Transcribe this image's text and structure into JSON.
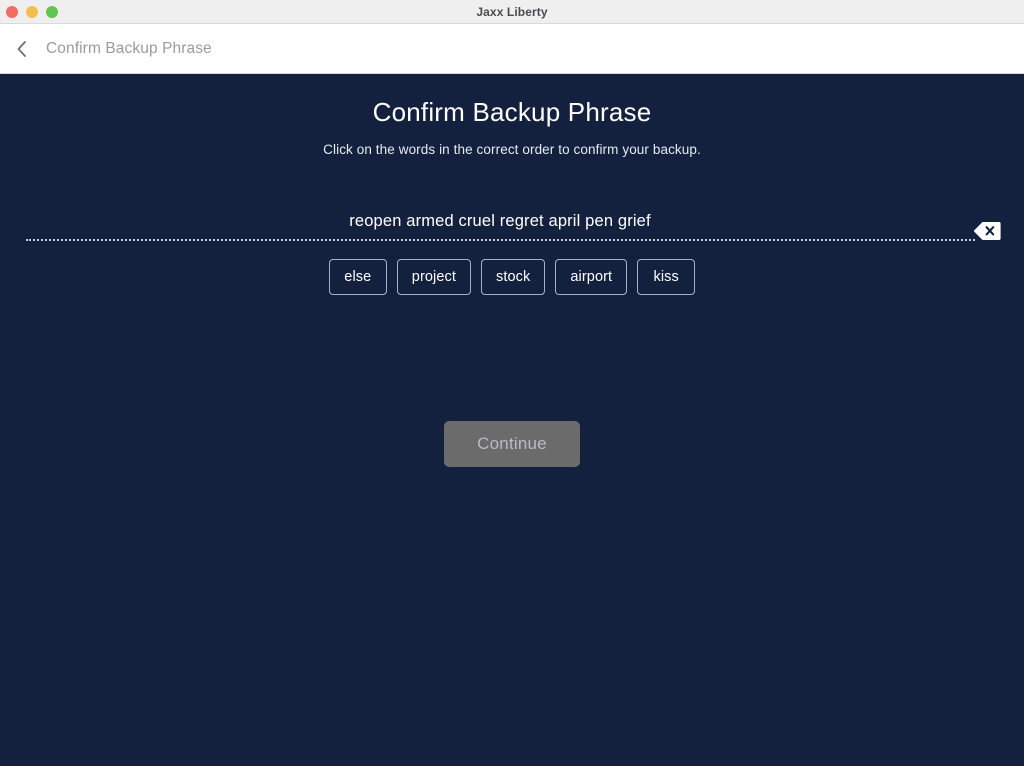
{
  "window": {
    "title": "Jaxx Liberty",
    "controls": [
      {
        "name": "close",
        "color": "#ef6e61"
      },
      {
        "name": "minimize",
        "color": "#f4bd4f"
      },
      {
        "name": "maximize",
        "color": "#61c554"
      }
    ]
  },
  "navbar": {
    "back_icon": "chevron-left-icon",
    "title": "Confirm Backup Phrase"
  },
  "main": {
    "heading": "Confirm Backup Phrase",
    "subheading": "Click on the words in the correct order to confirm your backup.",
    "phrase_input": {
      "value": "reopen armed cruel regret april pen grief",
      "placeholder": "",
      "backspace_icon": "backspace-delete-icon"
    },
    "word_choices": [
      {
        "label": "else"
      },
      {
        "label": "project"
      },
      {
        "label": "stock"
      },
      {
        "label": "airport"
      },
      {
        "label": "kiss"
      }
    ],
    "continue_button": {
      "label": "Continue",
      "enabled": false
    }
  },
  "colors": {
    "background": "#13213f",
    "titlebar": "#efefef",
    "navbar": "#ffffff",
    "accent_text": "#ffffff",
    "muted_text": "#9a9aa6",
    "button_border": "#a8b0c4",
    "continue_disabled": "#6b6b6b",
    "continue_disabled_text": "#b6bbc6"
  }
}
